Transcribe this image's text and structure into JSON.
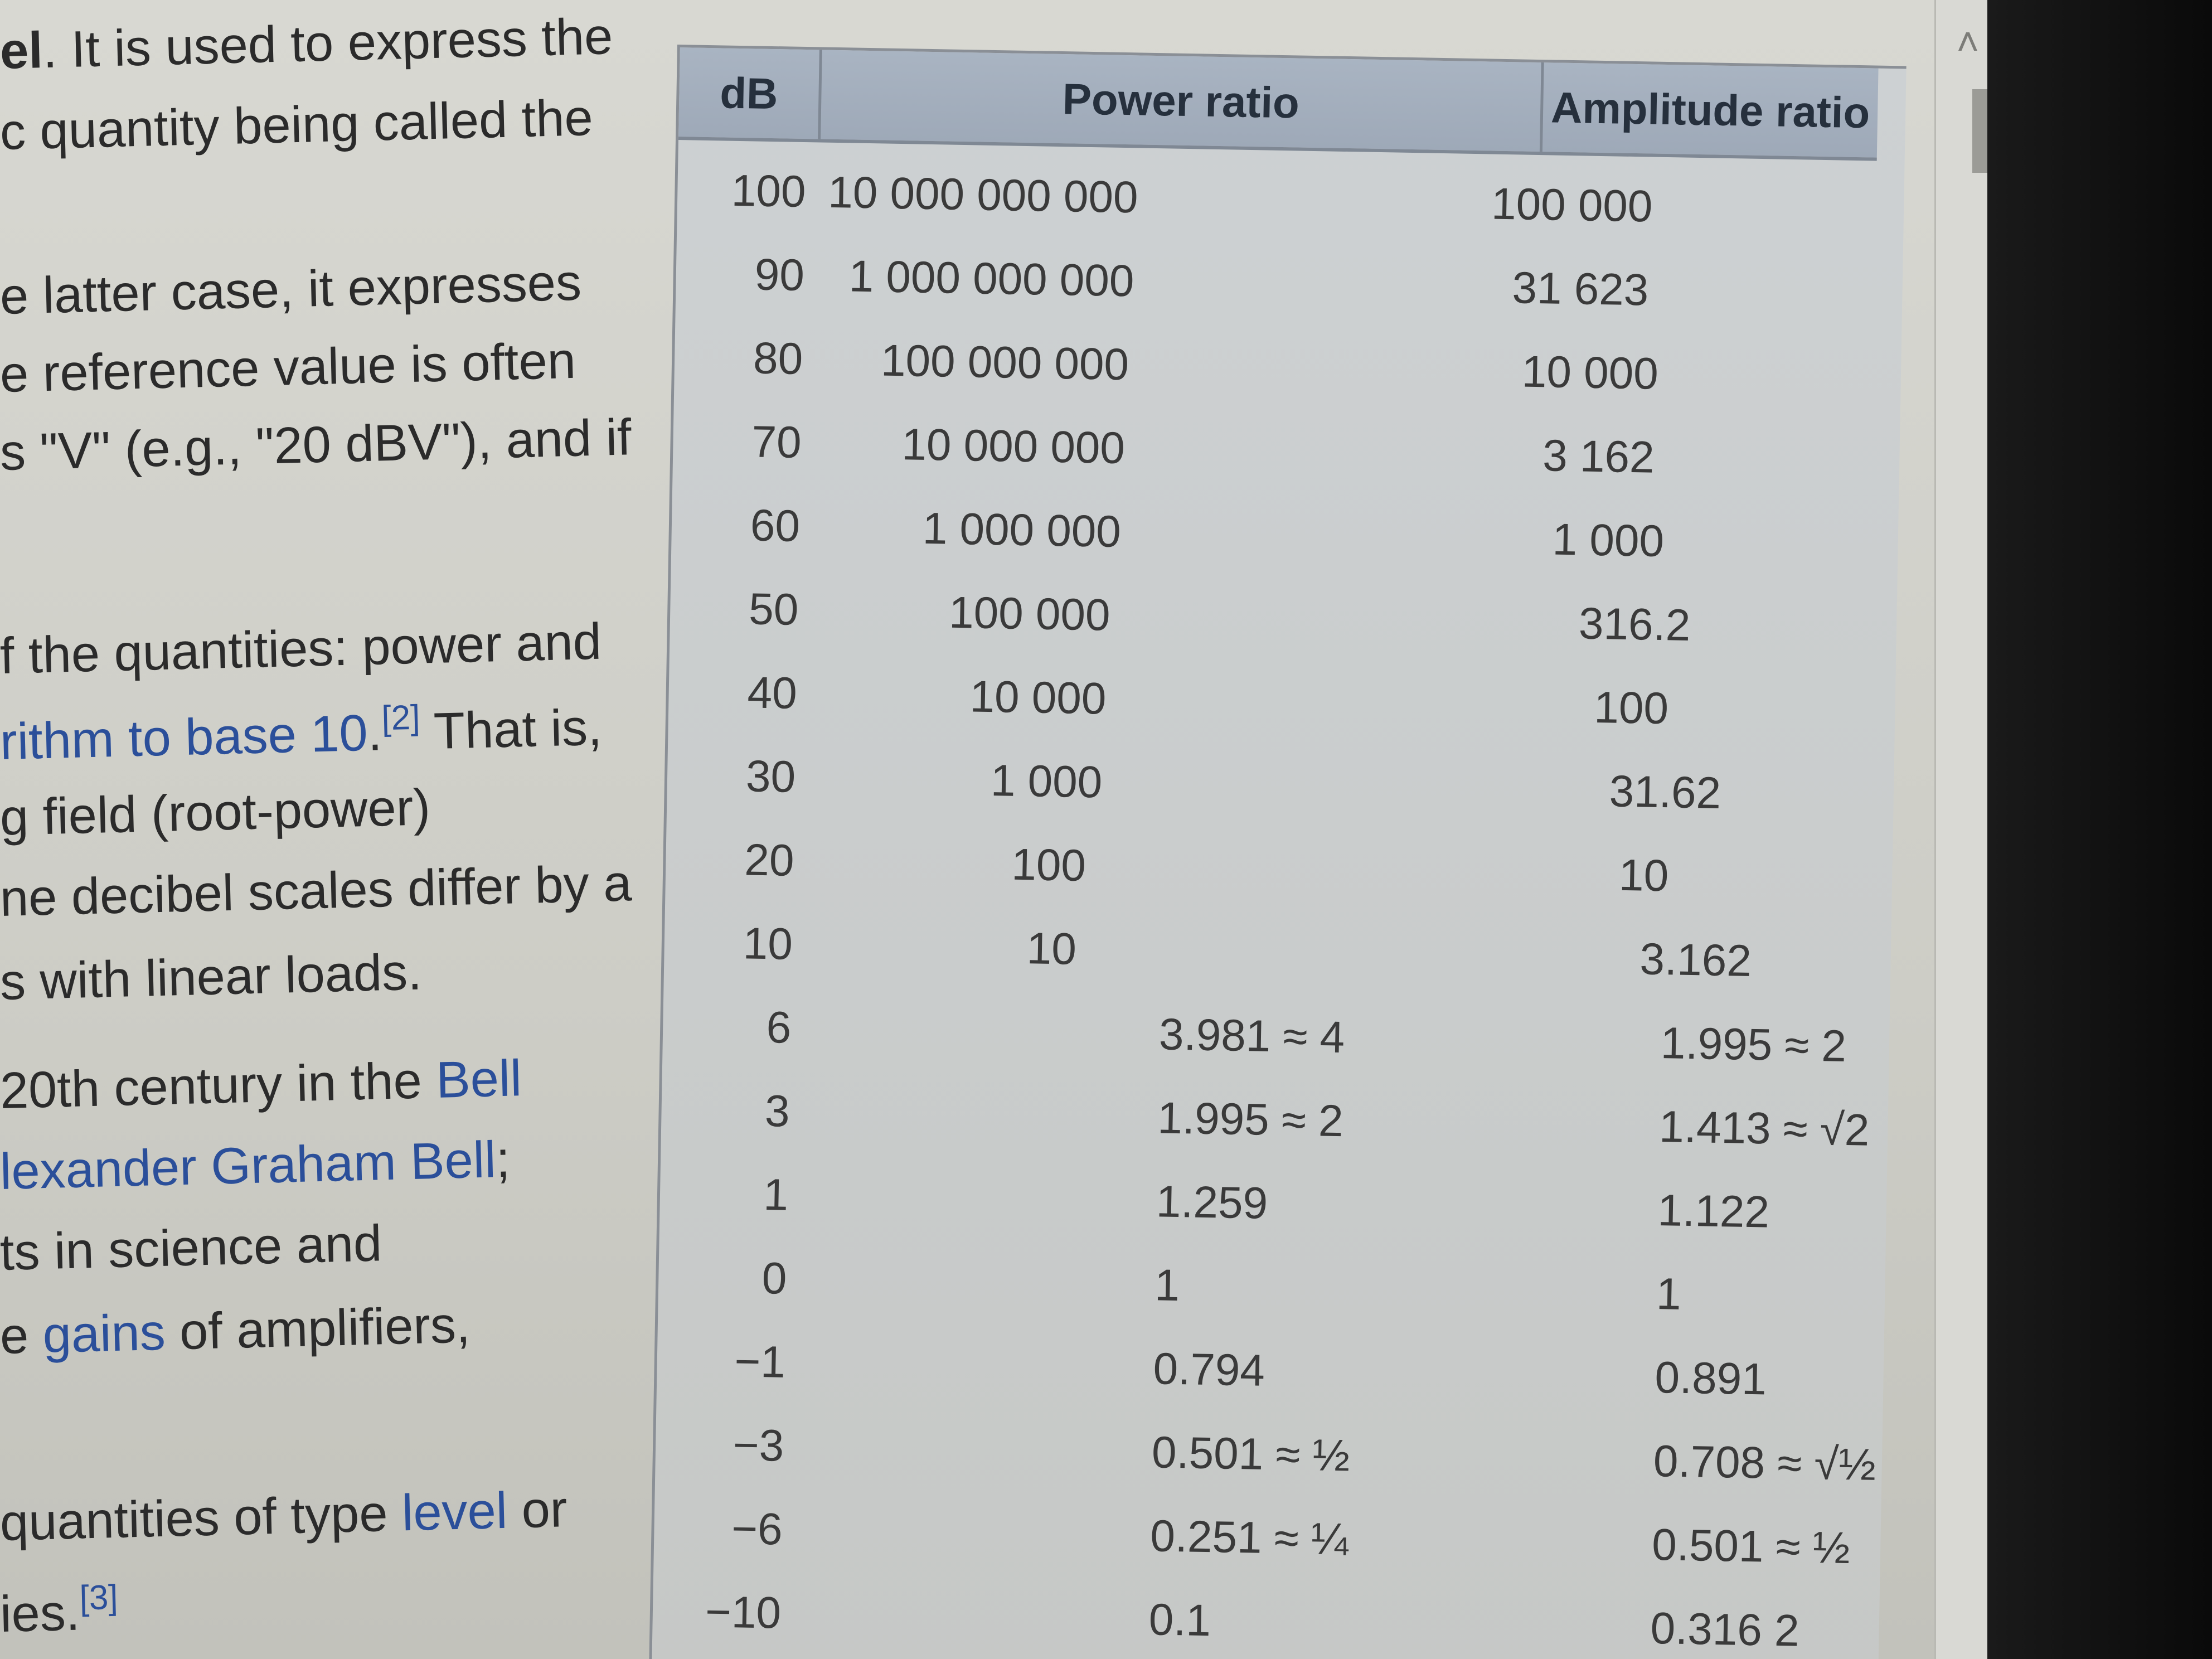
{
  "article": {
    "lines": [
      {
        "parts": [
          {
            "t": "el",
            "b": true
          },
          {
            "t": ". It is used to express the"
          }
        ]
      },
      {
        "parts": [
          {
            "t": "c quantity being called the"
          }
        ]
      },
      {
        "parts": [
          {
            "t": "e latter case, it expresses"
          }
        ]
      },
      {
        "parts": [
          {
            "t": "e reference value is often"
          }
        ]
      },
      {
        "parts": [
          {
            "t": "s \"V\" (e.g., \"20 dBV\"), and if"
          }
        ]
      },
      {
        "parts": [
          {
            "t": "f the quantities: power and"
          }
        ]
      },
      {
        "parts": [
          {
            "t": "rithm to base 10",
            "link": true
          },
          {
            "t": ".",
            "link": false
          },
          {
            "t": "[2]",
            "sup": true
          },
          {
            "t": " That is,"
          }
        ]
      },
      {
        "parts": [
          {
            "t": "g field (root-power)"
          }
        ]
      },
      {
        "parts": [
          {
            "t": "ne decibel scales differ by a"
          }
        ]
      },
      {
        "parts": [
          {
            "t": "s with linear loads."
          }
        ]
      },
      {
        "parts": [
          {
            "t": "20th century in the "
          },
          {
            "t": "Bell",
            "link": true
          }
        ]
      },
      {
        "parts": [
          {
            "t": "lexander Graham Bell",
            "link": true
          },
          {
            "t": ";"
          }
        ]
      },
      {
        "parts": [
          {
            "t": "ts in science and"
          }
        ]
      },
      {
        "parts": [
          {
            "t": "e "
          },
          {
            "t": "gains",
            "link": true
          },
          {
            "t": " of amplifiers,"
          }
        ]
      },
      {
        "parts": [
          {
            "t": "quantities of type "
          },
          {
            "t": "level",
            "link": true
          },
          {
            "t": " or"
          }
        ]
      },
      {
        "parts": [
          {
            "t": "ies."
          },
          {
            "t": "[3]",
            "sup": true
          }
        ]
      }
    ]
  },
  "table": {
    "headers": {
      "db": "dB",
      "power": "Power ratio",
      "amplitude": "Amplitude ratio"
    },
    "rows": [
      {
        "db": "100",
        "power": "10 000 000 000",
        "amplitude": "100 000"
      },
      {
        "db": "90",
        "power": "1 000 000 000",
        "amplitude": "31 623"
      },
      {
        "db": "80",
        "power": "100 000 000",
        "amplitude": "10 000"
      },
      {
        "db": "70",
        "power": "10 000 000",
        "amplitude": "3 162"
      },
      {
        "db": "60",
        "power": "1 000 000",
        "amplitude": "1 000"
      },
      {
        "db": "50",
        "power": "100 000",
        "amplitude": "316.2"
      },
      {
        "db": "40",
        "power": "10 000",
        "amplitude": "100"
      },
      {
        "db": "30",
        "power": "1 000",
        "amplitude": "31.62"
      },
      {
        "db": "20",
        "power": "100",
        "amplitude": "10"
      },
      {
        "db": "10",
        "power": "10",
        "amplitude": "3.162"
      },
      {
        "db": "6",
        "power": "3.981 ≈ 4",
        "amplitude": "1.995 ≈ 2"
      },
      {
        "db": "3",
        "power": "1.995 ≈ 2",
        "amplitude": "1.413 ≈ √2"
      },
      {
        "db": "1",
        "power": "1.259",
        "amplitude": "1.122"
      },
      {
        "db": "0",
        "power": "1",
        "amplitude": "1"
      },
      {
        "db": "−1",
        "power": "0.794",
        "amplitude": "0.891"
      },
      {
        "db": "−3",
        "power": "0.501 ≈ ½",
        "amplitude": "0.708 ≈ √½"
      },
      {
        "db": "−6",
        "power": "0.251 ≈ ¼",
        "amplitude": "0.501 ≈ ½"
      },
      {
        "db": "−10",
        "power": "0.1",
        "amplitude": "0.316 2"
      }
    ]
  },
  "scrollbar": {
    "up_icon": "chevron-up-icon"
  }
}
